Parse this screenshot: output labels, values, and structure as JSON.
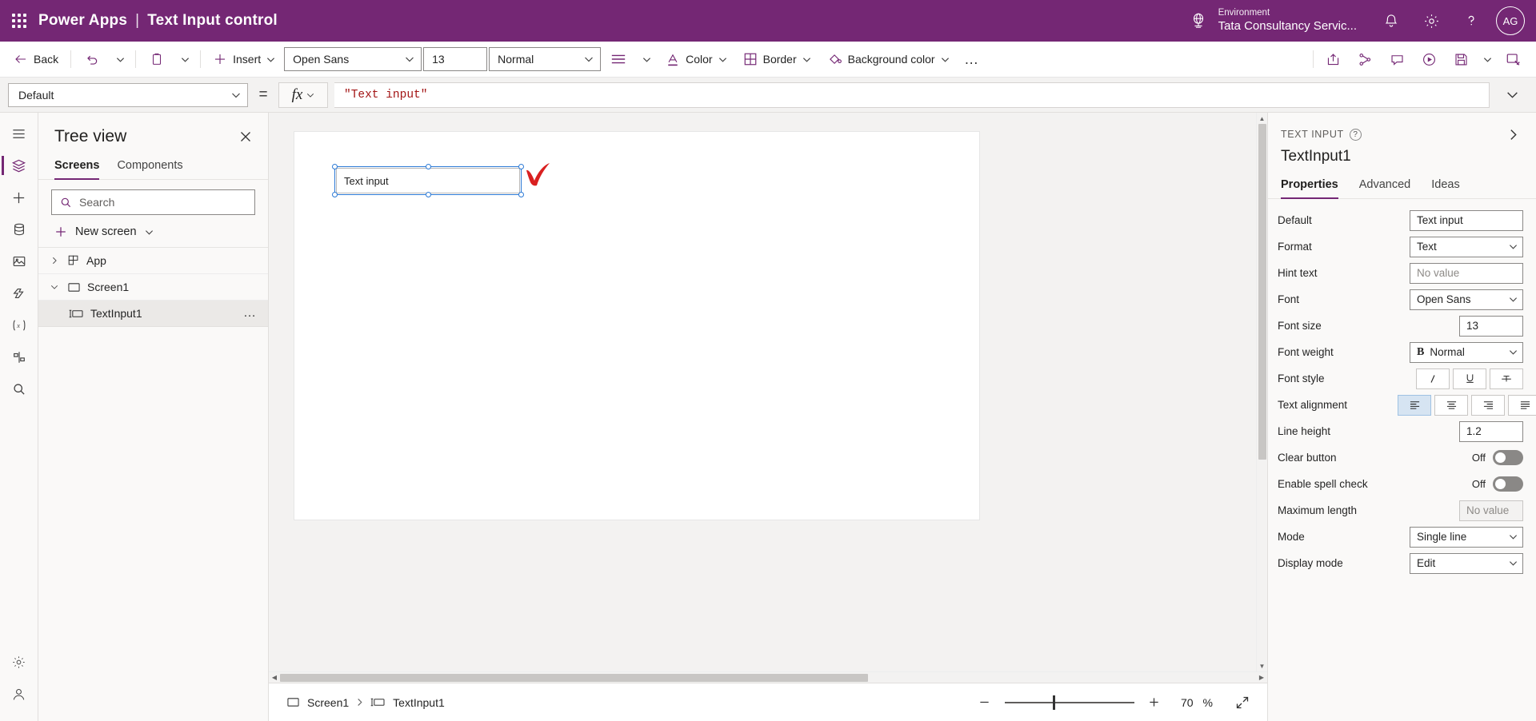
{
  "topbar": {
    "waffle": "app-launcher",
    "product": "Power Apps",
    "separator": "|",
    "app_title": "Text Input control",
    "environment_label": "Environment",
    "environment_name": "Tata Consultancy Servic...",
    "notifications_icon": "bell-icon",
    "settings_icon": "gear-icon",
    "help_icon": "help-icon",
    "avatar_initials": "AG"
  },
  "toolbar": {
    "back_label": "Back",
    "undo_icon": "undo-icon",
    "paste_icon": "clipboard-icon",
    "insert_label": "Insert",
    "font_family": "Open Sans",
    "font_size": "13",
    "font_weight": "Normal",
    "align_icon": "align-icon",
    "color_label": "Color",
    "border_label": "Border",
    "background_color_label": "Background color",
    "more_label": "…",
    "share_icon": "share-icon",
    "checker_icon": "app-checker-icon",
    "comments_icon": "comment-icon",
    "preview_icon": "play-icon",
    "save_icon": "save-icon",
    "save_caret_icon": "chevron-down-icon",
    "publish_icon": "publish-icon"
  },
  "formulabar": {
    "property": "Default",
    "equals": "=",
    "fx_label": "fx",
    "formula": "\"Text input\"",
    "expand_icon": "chevron-down-icon"
  },
  "rail": {
    "items": [
      {
        "name": "hamburger-icon",
        "active": false
      },
      {
        "name": "tree-view-icon",
        "active": true
      },
      {
        "name": "insert-icon",
        "active": false
      },
      {
        "name": "data-icon",
        "active": false
      },
      {
        "name": "media-icon",
        "active": false
      },
      {
        "name": "power-automate-icon",
        "active": false
      },
      {
        "name": "variables-icon",
        "active": false
      },
      {
        "name": "components-icon",
        "active": false
      },
      {
        "name": "search-icon",
        "active": false
      }
    ],
    "bottom_items": [
      {
        "name": "settings-gear-icon"
      },
      {
        "name": "account-icon"
      }
    ]
  },
  "treeview": {
    "title": "Tree view",
    "close_icon": "close-icon",
    "tabs": [
      {
        "label": "Screens",
        "active": true
      },
      {
        "label": "Components",
        "active": false
      }
    ],
    "search_placeholder": "Search",
    "search_value": "",
    "new_screen_label": "New screen",
    "items": [
      {
        "label": "App",
        "icon": "app-icon",
        "chevron": "chevron-right",
        "indent": 0,
        "selected": false
      },
      {
        "label": "Screen1",
        "icon": "screen-icon",
        "chevron": "chevron-down",
        "indent": 0,
        "selected": false
      },
      {
        "label": "TextInput1",
        "icon": "text-input-icon",
        "chevron": "",
        "indent": 1,
        "selected": true,
        "overflow": "…"
      }
    ]
  },
  "canvas": {
    "control_text": "Text input",
    "annotation": "red-check-mark"
  },
  "statusbar": {
    "breadcrumb": [
      {
        "label": "Screen1",
        "icon": "screen-icon"
      },
      {
        "label": "TextInput1",
        "icon": "text-input-icon"
      }
    ],
    "zoom_out_icon": "minus-icon",
    "zoom_in_icon": "plus-icon",
    "zoom_value": "70",
    "zoom_unit": "%",
    "fit_icon": "fit-screen-icon"
  },
  "properties": {
    "kicker": "TEXT INPUT",
    "help_icon": "help-circle-icon",
    "collapse_icon": "chevron-right-icon",
    "control_name": "TextInput1",
    "tabs": [
      {
        "label": "Properties",
        "active": true
      },
      {
        "label": "Advanced",
        "active": false
      },
      {
        "label": "Ideas",
        "active": false
      }
    ],
    "rows": [
      {
        "label": "Default",
        "type": "text",
        "value": "Text input"
      },
      {
        "label": "Format",
        "type": "select",
        "value": "Text"
      },
      {
        "label": "Hint text",
        "type": "text",
        "value": "",
        "placeholder": "No value"
      },
      {
        "label": "Font",
        "type": "select",
        "value": "Open Sans"
      },
      {
        "label": "Font size",
        "type": "text",
        "value": "13"
      },
      {
        "label": "Font weight",
        "type": "select-bold",
        "value": "Normal",
        "prefix": "B"
      },
      {
        "label": "Font style",
        "type": "segmented",
        "options": [
          "italic-icon",
          "underline-icon",
          "strikethrough-icon"
        ],
        "active": -1
      },
      {
        "label": "Text alignment",
        "type": "segmented",
        "options": [
          "align-left-icon",
          "align-center-icon",
          "align-right-icon",
          "align-justify-icon"
        ],
        "active": 0
      },
      {
        "label": "Line height",
        "type": "text",
        "value": "1.2"
      },
      {
        "label": "Clear button",
        "type": "toggle",
        "value": "Off"
      },
      {
        "label": "Enable spell check",
        "type": "toggle",
        "value": "Off"
      },
      {
        "label": "Maximum length",
        "type": "text-disabled",
        "value": "",
        "placeholder": "No value"
      },
      {
        "label": "Mode",
        "type": "select",
        "value": "Single line"
      },
      {
        "label": "Display mode",
        "type": "select",
        "value": "Edit"
      }
    ]
  },
  "colors": {
    "brand_purple": "#742774",
    "accent_purple": "#742774",
    "formula_red": "#a31515",
    "selection_blue": "#2c7ad6",
    "annotation_red": "#d92020"
  }
}
